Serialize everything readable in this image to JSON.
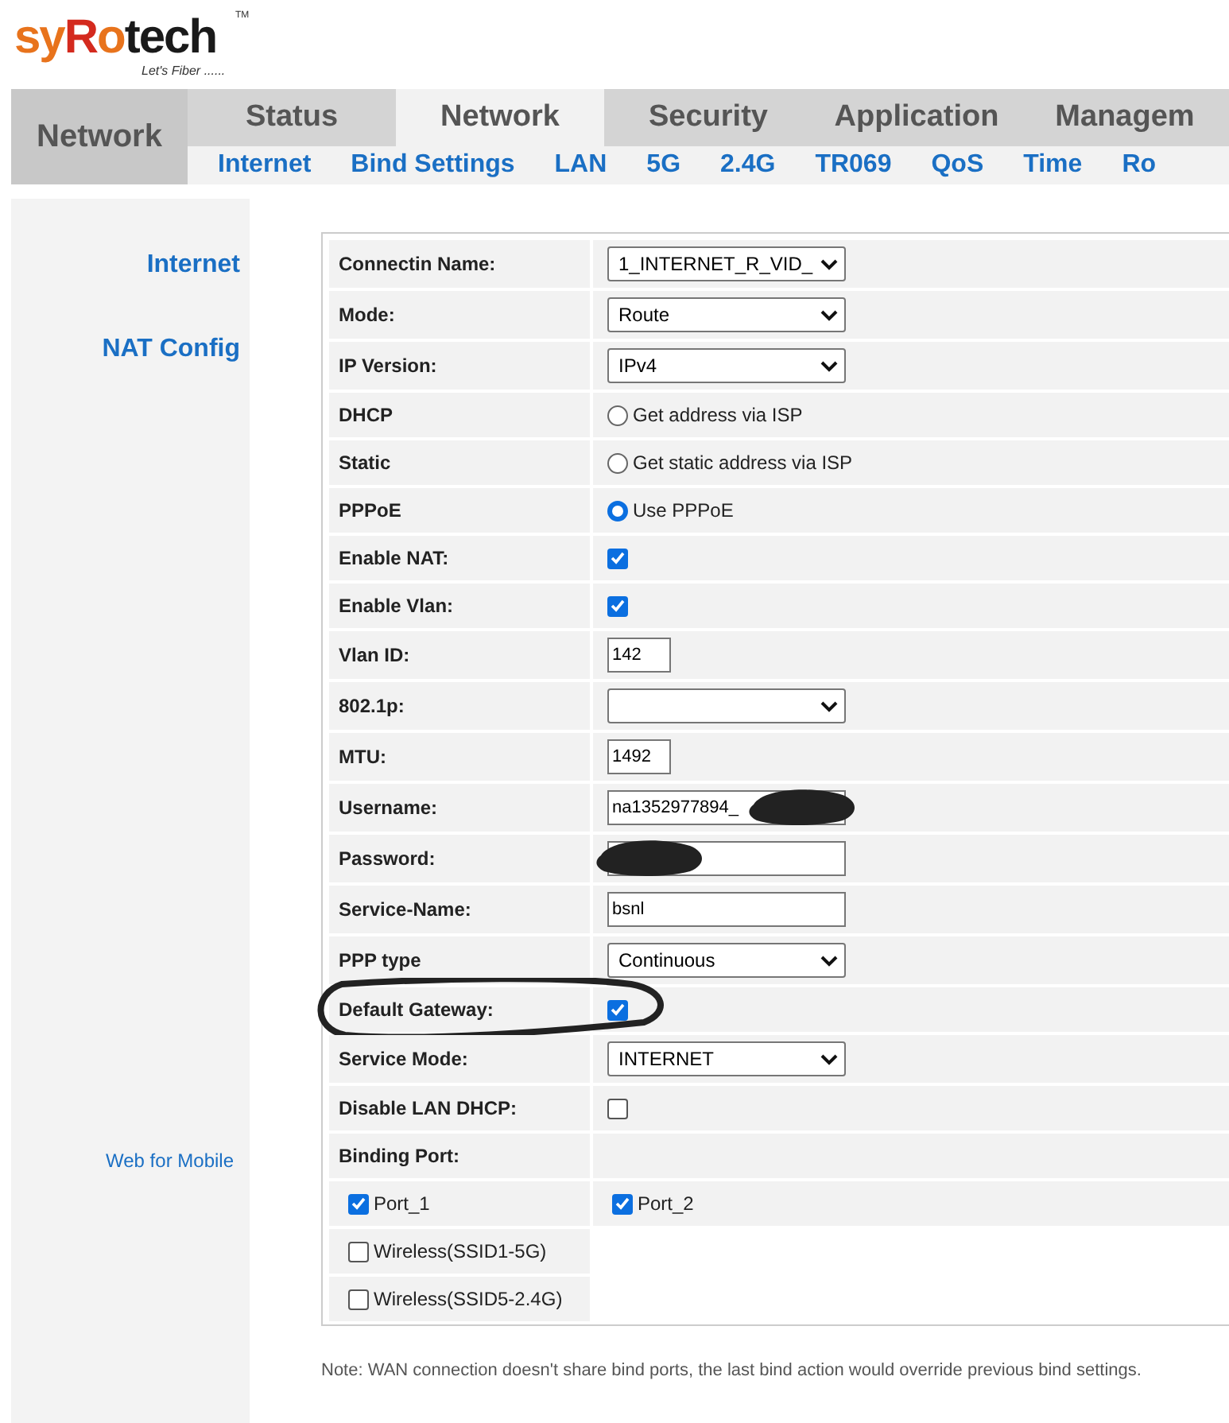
{
  "logo": {
    "parts": [
      {
        "text": "sy",
        "color": "#e8731c"
      },
      {
        "text": "R",
        "color": "#d42a1e"
      },
      {
        "text": "o",
        "color": "#e8731c"
      },
      {
        "text": "tech",
        "color": "#1a1a1a"
      }
    ],
    "mark": "TM",
    "tagline": "Let's Fiber ......"
  },
  "section_title": "Network",
  "tabs": [
    {
      "label": "Status",
      "selected": false
    },
    {
      "label": "Network",
      "selected": true
    },
    {
      "label": "Security",
      "selected": false
    },
    {
      "label": "Application",
      "selected": false
    },
    {
      "label": "Managem",
      "selected": false
    }
  ],
  "subtabs": [
    {
      "label": "Internet"
    },
    {
      "label": "Bind Settings"
    },
    {
      "label": "LAN"
    },
    {
      "label": "5G"
    },
    {
      "label": "2.4G"
    },
    {
      "label": "TR069"
    },
    {
      "label": "QoS"
    },
    {
      "label": "Time"
    },
    {
      "label": "Ro"
    }
  ],
  "sidebar": {
    "items": [
      {
        "label": "Internet"
      },
      {
        "label": "NAT Config"
      }
    ],
    "footer_link": "Web for Mobile"
  },
  "rows": [
    {
      "label": "Connectin Name:",
      "kind": "select",
      "value": "1_INTERNET_R_VID_"
    },
    {
      "label": "Mode:",
      "kind": "select",
      "value": "Route"
    },
    {
      "label": "IP Version:",
      "kind": "select",
      "value": "IPv4"
    },
    {
      "label": "DHCP",
      "kind": "radio",
      "option": "Get address via ISP",
      "selected": false
    },
    {
      "label": "Static",
      "kind": "radio",
      "option": "Get static address via ISP",
      "selected": false
    },
    {
      "label": "PPPoE",
      "kind": "radio",
      "option": "Use PPPoE",
      "selected": true
    },
    {
      "label": "Enable NAT:",
      "kind": "checkbox",
      "checked": true
    },
    {
      "label": "Enable Vlan:",
      "kind": "checkbox",
      "checked": true
    },
    {
      "label": "Vlan ID:",
      "kind": "short_text",
      "value": "142"
    },
    {
      "label": "802.1p:",
      "kind": "select"
    },
    {
      "label": "MTU:",
      "kind": "short_text",
      "value": "1492"
    },
    {
      "label": "Username:",
      "kind": "text",
      "value": "na1352977894_",
      "redacted": true
    },
    {
      "label": "Password:",
      "kind": "text",
      "redacted": true
    },
    {
      "label": "Service-Name:",
      "kind": "text",
      "value": "bsnl"
    },
    {
      "label": "PPP type",
      "kind": "select",
      "value": "Continuous"
    },
    {
      "label": "Default Gateway:",
      "kind": "checkbox",
      "checked": true,
      "circled": true
    },
    {
      "label": "Service Mode:",
      "kind": "select",
      "value": "INTERNET"
    },
    {
      "label": "Disable LAN DHCP:",
      "kind": "checkbox",
      "checked": false
    },
    {
      "label": "Binding Port:",
      "kind": "heading"
    }
  ],
  "ports": [
    [
      {
        "label": "Port_1",
        "checked": true
      },
      {
        "label": "Port_2",
        "checked": true
      }
    ],
    [
      {
        "label": "Wireless(SSID1-5G)",
        "checked": false
      }
    ],
    [
      {
        "label": "Wireless(SSID5-2.4G)",
        "checked": false
      }
    ]
  ],
  "note": "Note: WAN connection doesn't share bind ports, the last bind action would override previous bind settings."
}
